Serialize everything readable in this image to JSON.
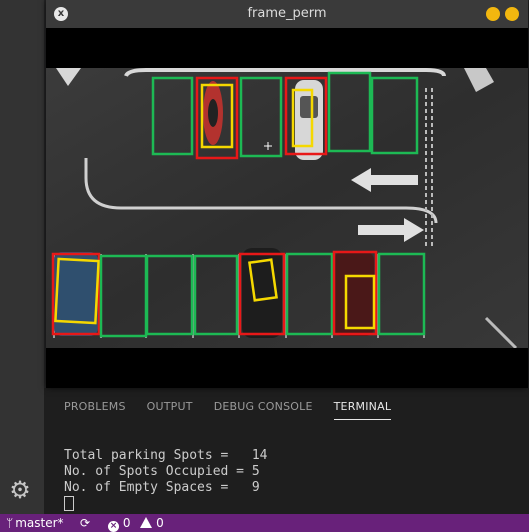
{
  "window": {
    "title": "frame_perm",
    "close_glyph": "x"
  },
  "panel": {
    "tabs": [
      "PROBLEMS",
      "OUTPUT",
      "DEBUG CONSOLE",
      "TERMINAL"
    ],
    "active_tab": "TERMINAL"
  },
  "terminal": {
    "lines": [
      "Total parking Spots =   14",
      "No. of Spots Occupied = 5",
      "No. of Empty Spaces =   9"
    ]
  },
  "statusbar": {
    "branch": "master*",
    "errors": "0",
    "warnings": "0"
  },
  "detection": {
    "total_spots": 14,
    "occupied": 5,
    "empty": 9,
    "colors": {
      "empty": "#1db954",
      "occupied": "#e81818",
      "car_box": "#f5d800"
    }
  },
  "icons": {
    "settings": "gear-icon",
    "branch": "git-branch-icon",
    "sync": "sync-icon",
    "errors": "error-icon",
    "warnings": "warning-icon"
  }
}
